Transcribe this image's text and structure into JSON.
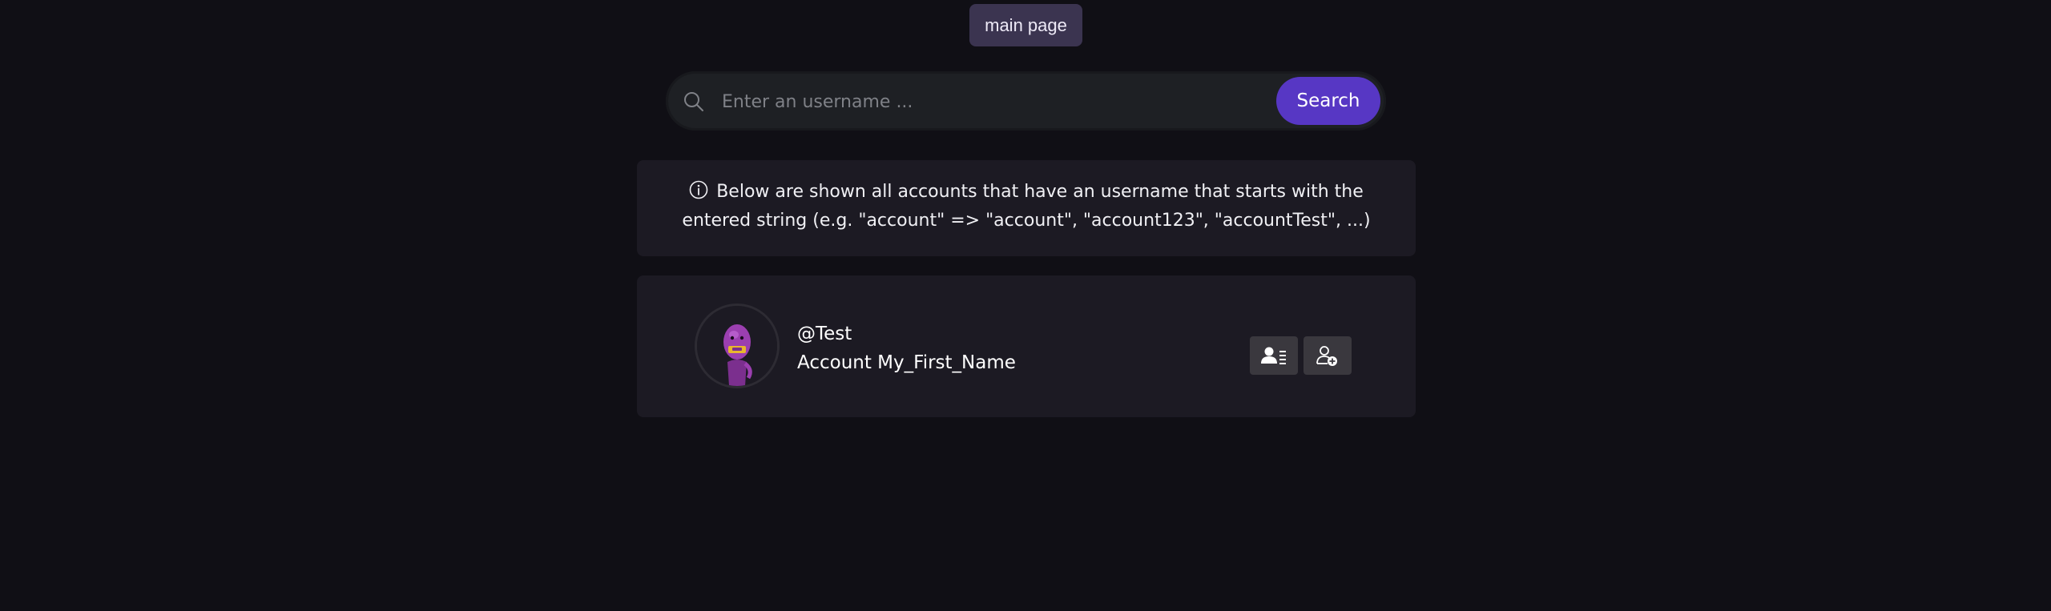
{
  "nav": {
    "main_page_label": "main page"
  },
  "search": {
    "placeholder": "Enter an username ...",
    "value": "",
    "button_label": "Search",
    "icon": "search-icon"
  },
  "info": {
    "icon": "info-icon",
    "text": "Below are shown all accounts that have an username that starts with the entered string (e.g. \"account\" => \"account\", \"account123\", \"accountTest\", ...)"
  },
  "results": [
    {
      "handle": "@Test",
      "name": "Account My_First_Name",
      "avatar": "purple-character-avatar",
      "actions": [
        {
          "icon": "profile-card-icon"
        },
        {
          "icon": "add-friend-icon"
        }
      ]
    }
  ],
  "colors": {
    "background": "#100f15",
    "card": "#1c1a23",
    "accent": "#5737c4",
    "nav_button": "#3b3450",
    "search_bar": "#1e2024",
    "action_button": "#3a383e"
  }
}
